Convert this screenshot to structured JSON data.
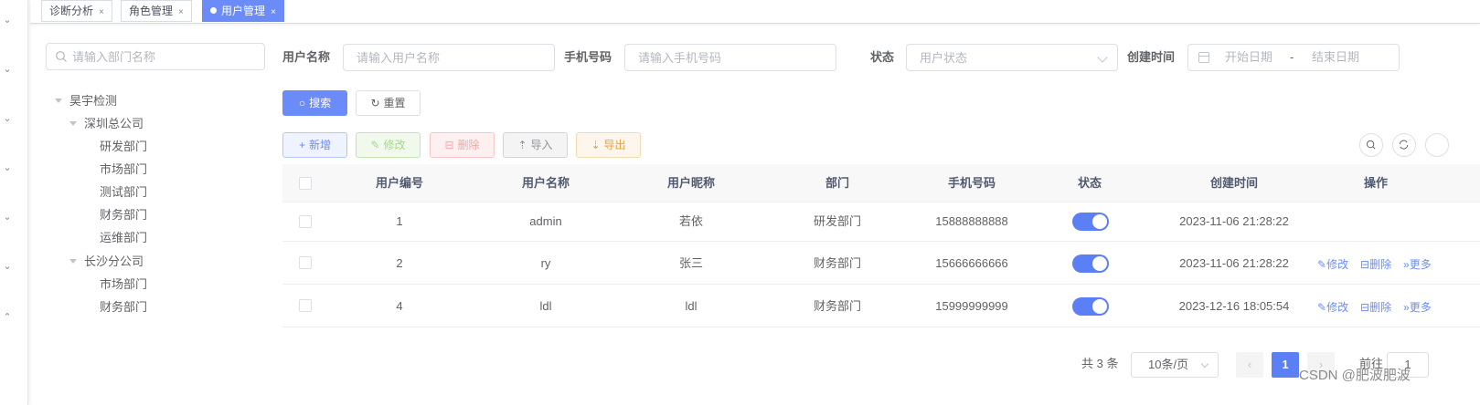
{
  "tabs": [
    {
      "label": "诊断分析",
      "active": false
    },
    {
      "label": "角色管理",
      "active": false
    },
    {
      "label": "用户管理",
      "active": true
    }
  ],
  "tab_close_glyph": "×",
  "dept_search": {
    "placeholder": "请输入部门名称"
  },
  "tree": {
    "root": "昊宇检测",
    "groups": [
      {
        "label": "深圳总公司",
        "children": [
          "研发部门",
          "市场部门",
          "测试部门",
          "财务部门",
          "运维部门"
        ]
      },
      {
        "label": "长沙分公司",
        "children": [
          "市场部门",
          "财务部门"
        ]
      }
    ]
  },
  "form": {
    "username_label": "用户名称",
    "username_placeholder": "请输入用户名称",
    "phone_label": "手机号码",
    "phone_placeholder": "请输入手机号码",
    "status_label": "状态",
    "status_placeholder": "用户状态",
    "created_label": "创建时间",
    "start_placeholder": "开始日期",
    "date_sep": "-",
    "end_placeholder": "结束日期",
    "search_btn": "搜索",
    "reset_btn": "重置"
  },
  "toolbar": {
    "add": "新增",
    "edit": "修改",
    "delete": "删除",
    "import": "导入",
    "export": "导出"
  },
  "table": {
    "headers": [
      "用户编号",
      "用户名称",
      "用户昵称",
      "部门",
      "手机号码",
      "状态",
      "创建时间",
      "操作"
    ],
    "rows": [
      {
        "id": "1",
        "username": "admin",
        "nickname": "若依",
        "dept": "研发部门",
        "phone": "15888888888",
        "status_on": true,
        "created": "2023-11-06 21:28:22",
        "actions": []
      },
      {
        "id": "2",
        "username": "ry",
        "nickname": "张三",
        "dept": "财务部门",
        "phone": "15666666666",
        "status_on": true,
        "created": "2023-11-06 21:28:22",
        "actions": [
          "修改",
          "删除",
          "更多"
        ]
      },
      {
        "id": "4",
        "username": "ldl",
        "nickname": "ldl",
        "dept": "财务部门",
        "phone": "15999999999",
        "status_on": true,
        "created": "2023-12-16 18:05:54",
        "actions": [
          "修改",
          "删除",
          "更多"
        ]
      }
    ]
  },
  "pagination": {
    "total_text": "共 3 条",
    "page_size": "10条/页",
    "current_page": "1",
    "goto_label": "前往",
    "goto_value": "1"
  },
  "watermark": "CSDN @肥波肥波",
  "colors": {
    "primary": "#5b7ff5",
    "tab_active": "#6b8cf8"
  }
}
